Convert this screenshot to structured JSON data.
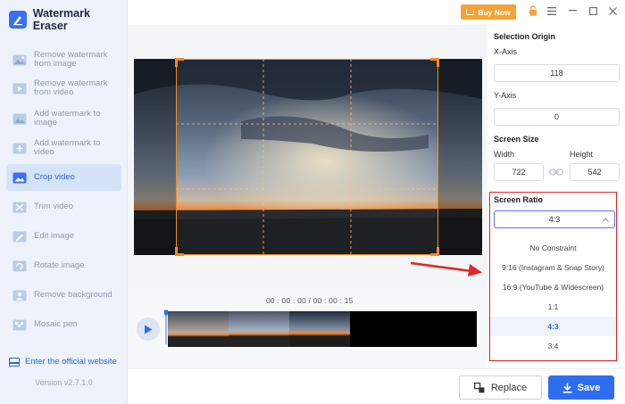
{
  "app": {
    "title": "Watermark Eraser",
    "version": "Version v2.7.1.0"
  },
  "titlebar": {
    "buy_label": "Buy Now"
  },
  "sidebar": {
    "items": [
      {
        "label": "Remove watermark from image",
        "icon": "image-eraser-icon"
      },
      {
        "label": "Remove watermark from video",
        "icon": "video-eraser-icon"
      },
      {
        "label": "Add watermark to image",
        "icon": "image-add-icon"
      },
      {
        "label": "Add watermark to video",
        "icon": "video-add-icon"
      },
      {
        "label": "Crop video",
        "icon": "crop-video-icon",
        "active": true
      },
      {
        "label": "Trim video",
        "icon": "trim-video-icon"
      },
      {
        "label": "Edit image",
        "icon": "edit-image-icon"
      },
      {
        "label": "Rotate image",
        "icon": "rotate-image-icon"
      },
      {
        "label": "Remove background",
        "icon": "remove-background-icon"
      },
      {
        "label": "Mosaic pen",
        "icon": "mosaic-pen-icon"
      }
    ],
    "official_link": "Enter the official website"
  },
  "timeline": {
    "time": "00 : 00 : 00 / 00 : 00 : 15"
  },
  "panel": {
    "selection_origin": "Selection Origin",
    "x_label": "X-Axis",
    "x_value": "118",
    "y_label": "Y-Axis",
    "y_value": "0",
    "screen_size": "Screen Size",
    "width_label": "Width",
    "height_label": "Height",
    "width_value": "722",
    "height_value": "542",
    "screen_ratio": "Screen Ratio",
    "ratio_value": "4:3",
    "ratio_options": [
      "No Constraint",
      "9:16 (Instagram & Snap Story)",
      "16:9 (YouTube & Widescreen)",
      "1:1",
      "4:3",
      "3:4"
    ],
    "selected_option": "4:3"
  },
  "footer": {
    "replace_label": "Replace",
    "save_label": "Save"
  },
  "colors": {
    "accent": "#2f6df0",
    "crop": "#f38a1c",
    "buy": "#f7a234",
    "highlight": "#e22626"
  }
}
